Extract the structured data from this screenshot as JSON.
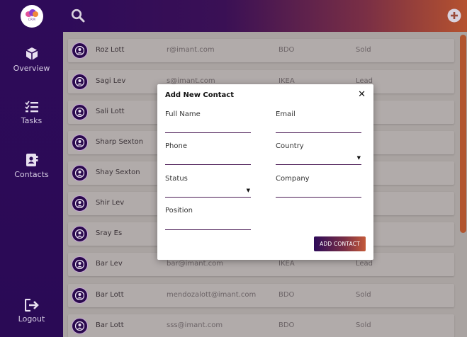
{
  "sidebar": {
    "logo_text": "CRM",
    "items": [
      {
        "label": "Overview",
        "icon": "cube-icon"
      },
      {
        "label": "Tasks",
        "icon": "checklist-icon"
      },
      {
        "label": "Contacts",
        "icon": "contacts-book-icon"
      },
      {
        "label": "Logout",
        "icon": "logout-icon"
      }
    ]
  },
  "topbar": {
    "search_icon": "search-icon",
    "add_icon": "plus-circle-icon"
  },
  "contacts": [
    {
      "name": "Roz Lott",
      "email": "r@imant.com",
      "company": "BDO",
      "status": "Sold"
    },
    {
      "name": "Sagi Lev",
      "email": "s@imant.com",
      "company": "IKEA",
      "status": "Lead"
    },
    {
      "name": "Sali Lott",
      "email": "",
      "company": "",
      "status": ""
    },
    {
      "name": "Sharp Sexton",
      "email": "",
      "company": "",
      "status": ""
    },
    {
      "name": "Shay Sexton",
      "email": "",
      "company": "",
      "status": ""
    },
    {
      "name": "Shir Lev",
      "email": "",
      "company": "",
      "status": ""
    },
    {
      "name": "Sray Es",
      "email": "",
      "company": "",
      "status": ""
    },
    {
      "name": "Bar Lev",
      "email": "bar@imant.com",
      "company": "IKEA",
      "status": "Lead"
    },
    {
      "name": "Bar Lott",
      "email": "mendozalott@imant.com",
      "company": "BDO",
      "status": "Sold"
    },
    {
      "name": "Bar Lott",
      "email": "sss@imant.com",
      "company": "BDO",
      "status": "Sold"
    }
  ],
  "modal": {
    "title": "Add New Contact",
    "close": "✕",
    "fields": {
      "full_name": {
        "label": "Full Name",
        "value": ""
      },
      "email": {
        "label": "Email",
        "value": ""
      },
      "phone": {
        "label": "Phone",
        "value": ""
      },
      "country": {
        "label": "Country",
        "value": ""
      },
      "status": {
        "label": "Status",
        "value": ""
      },
      "company": {
        "label": "Company",
        "value": ""
      },
      "position": {
        "label": "Position",
        "value": ""
      }
    },
    "submit_label": "ADD CONTACT"
  },
  "colors": {
    "sidebar": "#2e0b59",
    "accent": "#b5522f",
    "row_bg": "#b1abaa"
  }
}
